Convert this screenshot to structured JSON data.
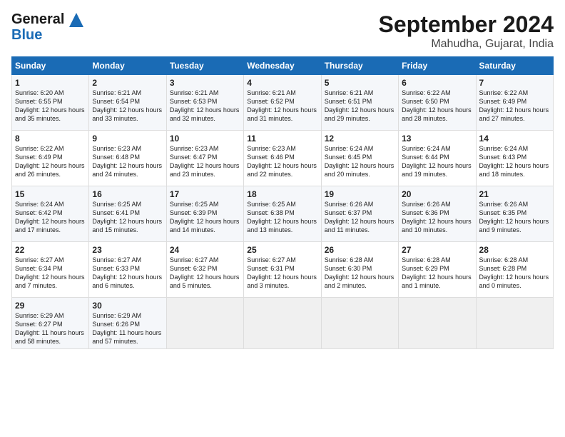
{
  "header": {
    "logo_line1": "General",
    "logo_line2": "Blue",
    "month": "September 2024",
    "location": "Mahudha, Gujarat, India"
  },
  "days_of_week": [
    "Sunday",
    "Monday",
    "Tuesday",
    "Wednesday",
    "Thursday",
    "Friday",
    "Saturday"
  ],
  "weeks": [
    [
      {
        "day": "1",
        "sunrise": "6:20 AM",
        "sunset": "6:55 PM",
        "daylight": "12 hours and 35 minutes."
      },
      {
        "day": "2",
        "sunrise": "6:21 AM",
        "sunset": "6:54 PM",
        "daylight": "12 hours and 33 minutes."
      },
      {
        "day": "3",
        "sunrise": "6:21 AM",
        "sunset": "6:53 PM",
        "daylight": "12 hours and 32 minutes."
      },
      {
        "day": "4",
        "sunrise": "6:21 AM",
        "sunset": "6:52 PM",
        "daylight": "12 hours and 31 minutes."
      },
      {
        "day": "5",
        "sunrise": "6:21 AM",
        "sunset": "6:51 PM",
        "daylight": "12 hours and 29 minutes."
      },
      {
        "day": "6",
        "sunrise": "6:22 AM",
        "sunset": "6:50 PM",
        "daylight": "12 hours and 28 minutes."
      },
      {
        "day": "7",
        "sunrise": "6:22 AM",
        "sunset": "6:49 PM",
        "daylight": "12 hours and 27 minutes."
      }
    ],
    [
      {
        "day": "8",
        "sunrise": "6:22 AM",
        "sunset": "6:49 PM",
        "daylight": "12 hours and 26 minutes."
      },
      {
        "day": "9",
        "sunrise": "6:23 AM",
        "sunset": "6:48 PM",
        "daylight": "12 hours and 24 minutes."
      },
      {
        "day": "10",
        "sunrise": "6:23 AM",
        "sunset": "6:47 PM",
        "daylight": "12 hours and 23 minutes."
      },
      {
        "day": "11",
        "sunrise": "6:23 AM",
        "sunset": "6:46 PM",
        "daylight": "12 hours and 22 minutes."
      },
      {
        "day": "12",
        "sunrise": "6:24 AM",
        "sunset": "6:45 PM",
        "daylight": "12 hours and 20 minutes."
      },
      {
        "day": "13",
        "sunrise": "6:24 AM",
        "sunset": "6:44 PM",
        "daylight": "12 hours and 19 minutes."
      },
      {
        "day": "14",
        "sunrise": "6:24 AM",
        "sunset": "6:43 PM",
        "daylight": "12 hours and 18 minutes."
      }
    ],
    [
      {
        "day": "15",
        "sunrise": "6:24 AM",
        "sunset": "6:42 PM",
        "daylight": "12 hours and 17 minutes."
      },
      {
        "day": "16",
        "sunrise": "6:25 AM",
        "sunset": "6:41 PM",
        "daylight": "12 hours and 15 minutes."
      },
      {
        "day": "17",
        "sunrise": "6:25 AM",
        "sunset": "6:39 PM",
        "daylight": "12 hours and 14 minutes."
      },
      {
        "day": "18",
        "sunrise": "6:25 AM",
        "sunset": "6:38 PM",
        "daylight": "12 hours and 13 minutes."
      },
      {
        "day": "19",
        "sunrise": "6:26 AM",
        "sunset": "6:37 PM",
        "daylight": "12 hours and 11 minutes."
      },
      {
        "day": "20",
        "sunrise": "6:26 AM",
        "sunset": "6:36 PM",
        "daylight": "12 hours and 10 minutes."
      },
      {
        "day": "21",
        "sunrise": "6:26 AM",
        "sunset": "6:35 PM",
        "daylight": "12 hours and 9 minutes."
      }
    ],
    [
      {
        "day": "22",
        "sunrise": "6:27 AM",
        "sunset": "6:34 PM",
        "daylight": "12 hours and 7 minutes."
      },
      {
        "day": "23",
        "sunrise": "6:27 AM",
        "sunset": "6:33 PM",
        "daylight": "12 hours and 6 minutes."
      },
      {
        "day": "24",
        "sunrise": "6:27 AM",
        "sunset": "6:32 PM",
        "daylight": "12 hours and 5 minutes."
      },
      {
        "day": "25",
        "sunrise": "6:27 AM",
        "sunset": "6:31 PM",
        "daylight": "12 hours and 3 minutes."
      },
      {
        "day": "26",
        "sunrise": "6:28 AM",
        "sunset": "6:30 PM",
        "daylight": "12 hours and 2 minutes."
      },
      {
        "day": "27",
        "sunrise": "6:28 AM",
        "sunset": "6:29 PM",
        "daylight": "12 hours and 1 minute."
      },
      {
        "day": "28",
        "sunrise": "6:28 AM",
        "sunset": "6:28 PM",
        "daylight": "12 hours and 0 minutes."
      }
    ],
    [
      {
        "day": "29",
        "sunrise": "6:29 AM",
        "sunset": "6:27 PM",
        "daylight": "11 hours and 58 minutes."
      },
      {
        "day": "30",
        "sunrise": "6:29 AM",
        "sunset": "6:26 PM",
        "daylight": "11 hours and 57 minutes."
      },
      null,
      null,
      null,
      null,
      null
    ]
  ]
}
